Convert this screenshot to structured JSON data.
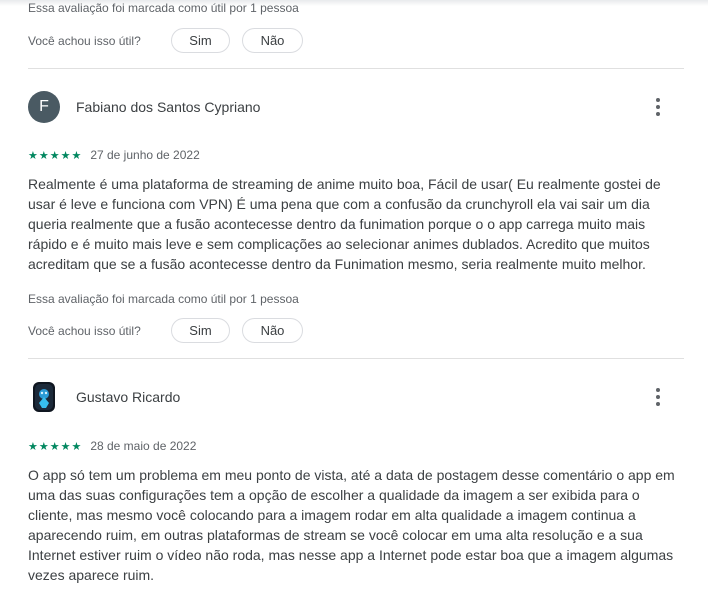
{
  "review0": {
    "helpful_text": "Essa avaliação foi marcada como útil por 1 pessoa",
    "question": "Você achou isso útil?",
    "yes": "Sim",
    "no": "Não"
  },
  "review1": {
    "avatar_letter": "F",
    "author": "Fabiano dos Santos Cypriano",
    "stars": "★★★★★",
    "rating": 5,
    "date": "27 de junho de 2022",
    "text": "Realmente é uma plataforma de streaming de anime muito boa, Fácil de usar( Eu realmente gostei de usar é leve e funciona com VPN) É uma pena que com a confusão da crunchyroll ela vai sair um dia queria realmente que a fusão acontecesse dentro da funimation porque o o app carrega muito mais rápido e é muito mais leve e sem complicações ao selecionar animes dublados. Acredito que muitos acreditam que se a fusão acontecesse dentro da Funimation mesmo, seria realmente muito melhor.",
    "helpful_text": "Essa avaliação foi marcada como útil por 1 pessoa",
    "question": "Você achou isso útil?",
    "yes": "Sim",
    "no": "Não"
  },
  "review2": {
    "author": "Gustavo Ricardo",
    "stars": "★★★★★",
    "rating": 5,
    "date": "28 de maio de 2022",
    "text": "O app só tem um problema em meu ponto de vista, até a data de postagem desse comentário o app em uma das suas configurações tem a opção de escolher a qualidade da imagem a ser exibida para o cliente, mas mesmo você colocando para a imagem rodar em alta qualidade a imagem continua a aparecendo ruim, em outras plataformas de stream se você colocar em uma alta resolução e a sua Internet estiver ruim o vídeo não roda, mas nesse app a Internet pode estar boa que a imagem algumas vezes aparece ruim."
  },
  "colors": {
    "star": "#01875f",
    "avatar_bg": "#4a5a63",
    "text": "#3c4043",
    "muted": "#5f6368"
  }
}
